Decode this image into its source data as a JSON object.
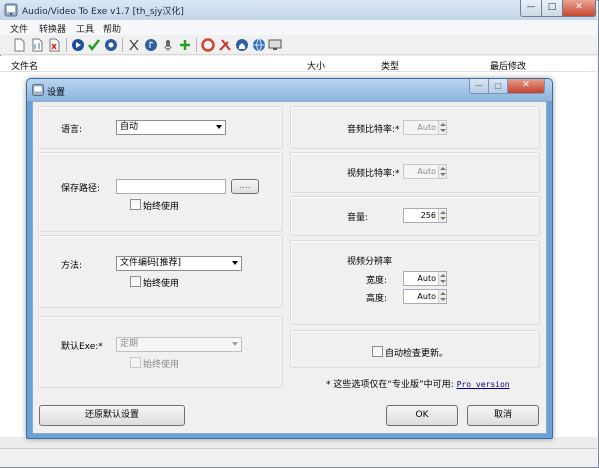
{
  "app": {
    "title": "Audio/Video To Exe v1.7 [th_sjy汉化]",
    "window_controls": {
      "minimize": "—",
      "maximize": "□",
      "close": "✕"
    }
  },
  "menu": {
    "items": [
      "文件",
      "转换器",
      "工具",
      "帮助"
    ]
  },
  "toolbar": {
    "icons": [
      "new-icon",
      "open-icon",
      "delete-icon",
      "play-icon",
      "check-icon",
      "settings-icon",
      "cut-icon",
      "music-icon",
      "mic-icon",
      "add-icon",
      "lifebuoy-icon",
      "tools-icon",
      "home-icon",
      "globe-icon",
      "screen-icon"
    ]
  },
  "list": {
    "columns": [
      "文件名",
      "大小",
      "类型",
      "最后修改"
    ]
  },
  "dialog": {
    "title": "设置",
    "window_controls": {
      "minimize": "—",
      "maximize": "□",
      "close": "✕"
    },
    "language": {
      "label": "语言:",
      "value": "自动"
    },
    "save_path": {
      "label": "保存路径:",
      "value": "",
      "browse_label": "....",
      "always_use_label": "始终使用"
    },
    "method": {
      "label": "方法:",
      "value": "文件编码[推荐]",
      "always_use_label": "始终使用"
    },
    "default_exe": {
      "label": "默认Exe:*",
      "value": "定期",
      "always_use_label": "始终使用"
    },
    "audio_bitrate": {
      "label": "音频比特率:*",
      "value": "Auto"
    },
    "video_bitrate": {
      "label": "视频比特率:*",
      "value": "Auto"
    },
    "volume": {
      "label": "音量:",
      "value": "256"
    },
    "video_resolution": {
      "label": "视频分辨率",
      "width_label": "宽度:",
      "width_value": "Auto",
      "height_label": "高度:",
      "height_value": "Auto"
    },
    "auto_update": {
      "label": "自动检查更新。"
    },
    "pro_note": {
      "text": "* 这些选项仅在“专业版”中可用:",
      "link": "Pro version"
    },
    "restore_defaults_label": "还原默认设置",
    "ok_label": "OK",
    "cancel_label": "取消"
  }
}
